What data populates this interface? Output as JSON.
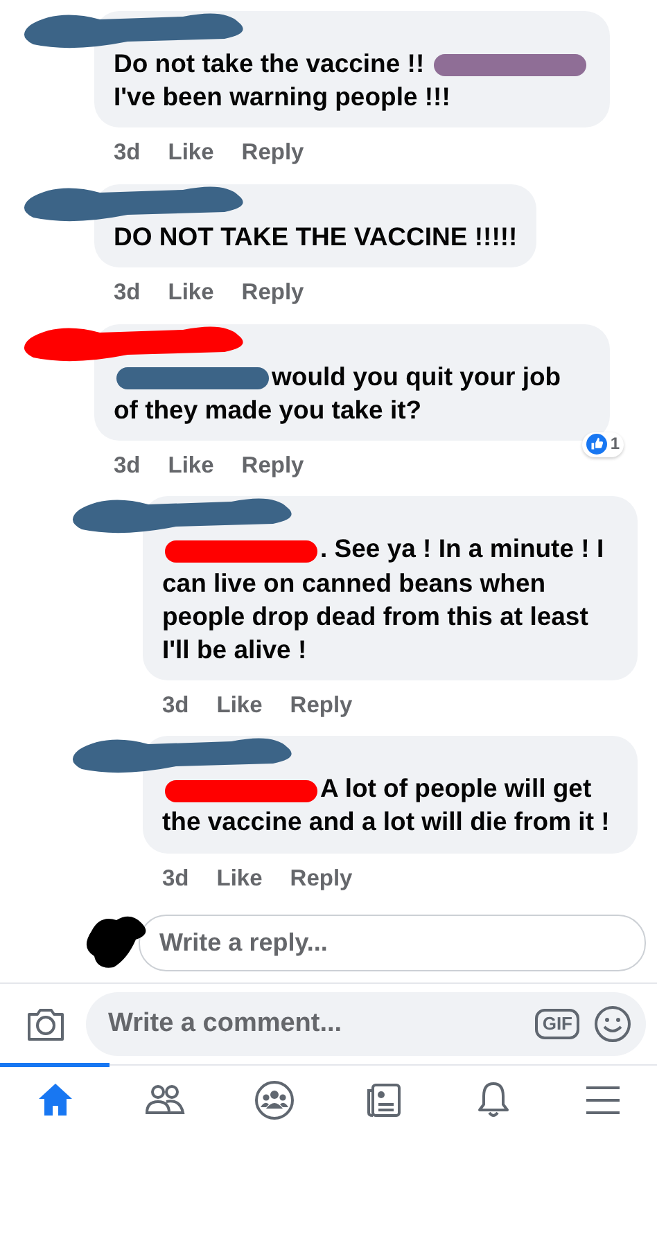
{
  "comments": [
    {
      "color": "#3c6487",
      "segments": [
        {
          "kind": "text",
          "text": "Do not take the vaccine !!"
        },
        {
          "kind": "redaction",
          "color": "#8f6e96"
        },
        {
          "kind": "text",
          "text": "I've been warning people !!!"
        }
      ],
      "time": "3d",
      "like": "Like",
      "reply": "Reply"
    },
    {
      "color": "#3c6487",
      "segments": [
        {
          "kind": "text",
          "text": "DO NOT TAKE THE VACCINE !!!!!"
        }
      ],
      "time": "3d",
      "like": "Like",
      "reply": "Reply"
    },
    {
      "color": "#ff0000",
      "segments": [
        {
          "kind": "redaction",
          "color": "#3c6487"
        },
        {
          "kind": "text",
          "text": "would you quit your job of they made you take it?"
        }
      ],
      "time": "3d",
      "like": "Like",
      "reply": "Reply",
      "reactions": "1",
      "children": [
        {
          "color": "#3c6487",
          "segments": [
            {
              "kind": "redaction",
              "color": "#ff0000"
            },
            {
              "kind": "text",
              "text": ". See ya ! In a minute ! I can live on canned beans when people drop dead from this at least I'll be alive !"
            }
          ],
          "time": "3d",
          "like": "Like",
          "reply": "Reply"
        },
        {
          "color": "#3c6487",
          "segments": [
            {
              "kind": "redaction",
              "color": "#ff0000"
            },
            {
              "kind": "text",
              "text": "A lot of people will get the vaccine and a lot will die from it !"
            }
          ],
          "time": "3d",
          "like": "Like",
          "reply": "Reply"
        }
      ]
    }
  ],
  "reply_field": {
    "placeholder": "Write a reply..."
  },
  "comment_bar": {
    "placeholder": "Write a comment...",
    "gif": "GIF"
  },
  "tabs": [
    {
      "kind": "home",
      "selected": true
    },
    {
      "kind": "friends",
      "selected": false
    },
    {
      "kind": "groups",
      "selected": false
    },
    {
      "kind": "news",
      "selected": false
    },
    {
      "kind": "bell",
      "selected": false
    },
    {
      "kind": "menu",
      "selected": false
    }
  ]
}
